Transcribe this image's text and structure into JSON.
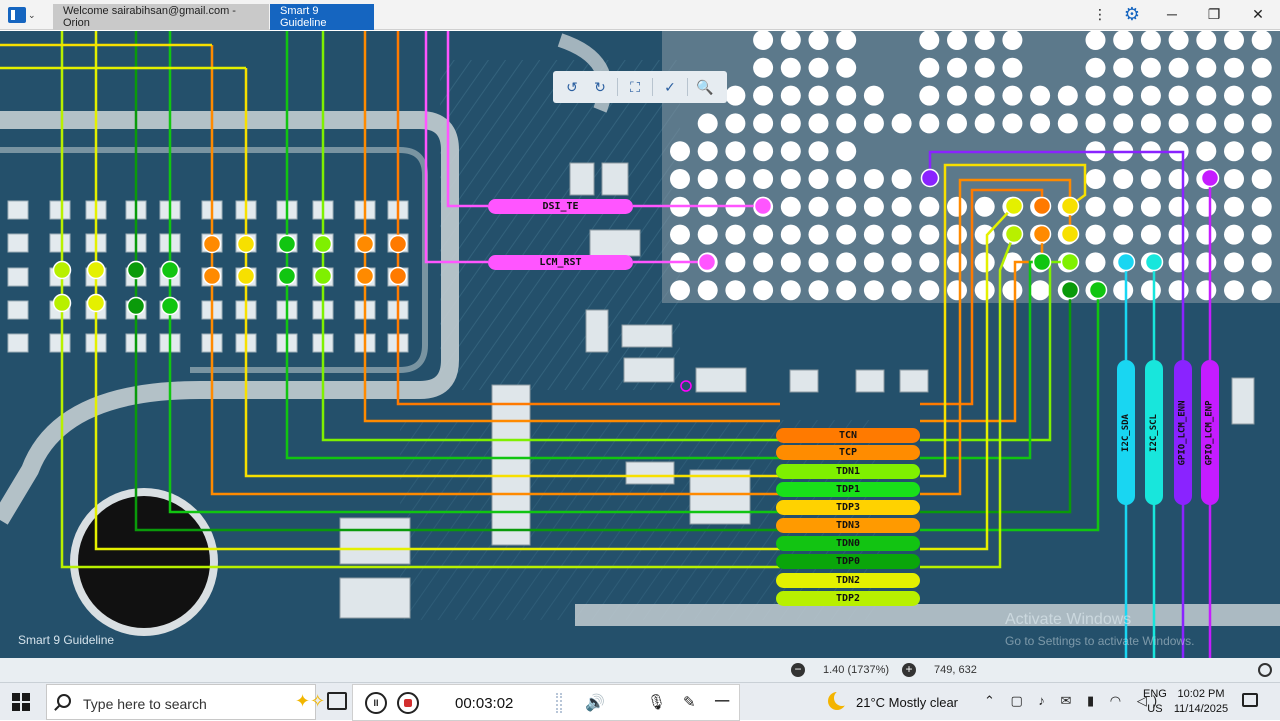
{
  "window": {
    "tabs": [
      {
        "label": "Welcome sairabihsan@gmail.com - Orion",
        "active": false
      },
      {
        "label": "Smart 9 Guideline",
        "active": true
      }
    ],
    "controls": {
      "more": "⋮",
      "settings": "⚙",
      "minimize": "─",
      "restore": "❐",
      "close": "✕"
    }
  },
  "board": {
    "watermark_label": "Smart 9 Guideline",
    "activation_notice": "Activate Windows",
    "activation_sub": "Go to Settings to activate Windows.",
    "colors": {
      "board": "#24506b",
      "lime": "#b8f000",
      "yellow": "#f7e000",
      "orange": "#ff8a00",
      "green": "#11c511",
      "darkgreen": "#0a9a0a",
      "magenta": "#ff55ff",
      "cyan": "#19d6f2",
      "purple": "#8a23ff",
      "violet": "#c51cff"
    },
    "net_labels_h": [
      {
        "text": "DSI_TE",
        "color": "#ff55ff"
      },
      {
        "text": "LCM_RST",
        "color": "#ff55ff"
      },
      {
        "text": "TCN",
        "color": "#ff7a00"
      },
      {
        "text": "TCP",
        "color": "#ff8c00"
      },
      {
        "text": "TDN1",
        "color": "#7ff000"
      },
      {
        "text": "TDP1",
        "color": "#19e019"
      },
      {
        "text": "TDP3",
        "color": "#ffd200"
      },
      {
        "text": "TDN3",
        "color": "#ff9a00"
      },
      {
        "text": "TDN0",
        "color": "#12c412"
      },
      {
        "text": "TDP0",
        "color": "#0aa50a"
      },
      {
        "text": "TDN2",
        "color": "#e4f000"
      },
      {
        "text": "TDP2",
        "color": "#b8f000"
      }
    ],
    "net_labels_v": [
      {
        "text": "I2C_SDA",
        "color": "#19d6f2"
      },
      {
        "text": "I2C_SCL",
        "color": "#18e6dc"
      },
      {
        "text": "GPIO_LCM_ENN",
        "color": "#8a23ff"
      },
      {
        "text": "GPIO_LCM_ENP",
        "color": "#c51cff"
      }
    ]
  },
  "toolbar": {
    "icons": [
      "rotate-left-icon",
      "rotate-right-icon",
      "fit-screen-icon",
      "measure-icon",
      "search-icon"
    ],
    "glyphs": {
      "rotate_left": "↺",
      "rotate_right": "↻",
      "fit": "⛶",
      "measure": "✓",
      "search": "🔍"
    }
  },
  "status": {
    "zoom_minus": "−",
    "zoom": "1.40 (1737%)",
    "zoom_plus": "+",
    "coords": "749, 632"
  },
  "taskbar": {
    "search_placeholder": "Type here to search",
    "recording_time": "00:03:02",
    "pause_glyph": "II",
    "volume_glyph": "🔊",
    "mic_glyph": "🎙",
    "pen_glyph": "✎",
    "minimize_glyph": "─",
    "weather": "21°C  Mostly clear",
    "tray_glyphs": "⌃ ▢ ♪ ✉ ▮ ◠ ◁)",
    "lang_line1": "ENG",
    "lang_line2": "US",
    "time": "10:02 PM",
    "date": "11/14/2025"
  }
}
